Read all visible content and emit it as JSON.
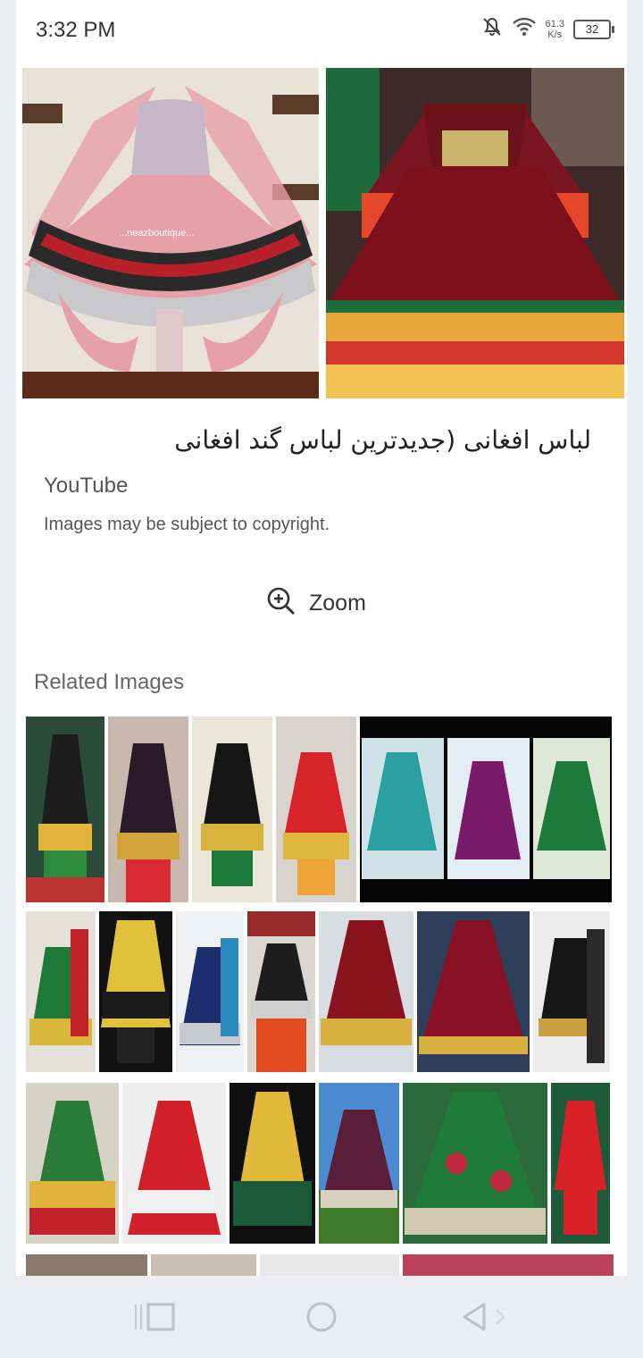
{
  "status_bar": {
    "time": "3:32 PM",
    "net_speed_value": "61.3",
    "net_speed_unit": "K/s",
    "battery": "32",
    "icons": [
      "mute-bell-icon",
      "wifi-icon"
    ]
  },
  "result": {
    "title": "لباس افغانی (جدیدترین لباس گند افغانی",
    "source": "YouTube",
    "copyright": "Images may be subject to copyright.",
    "zoom_label": "Zoom",
    "hero_watermark": "...neazboutique..."
  },
  "related": {
    "title": "Related Images"
  },
  "colors": {
    "accent_red": "#8b1a1f",
    "accent_green": "#1f6b3a",
    "accent_gold": "#d4a93a",
    "nav_background": "#ecedf0"
  },
  "navigation": {
    "icons": [
      "recent-apps-icon",
      "home-icon",
      "back-icon"
    ]
  }
}
